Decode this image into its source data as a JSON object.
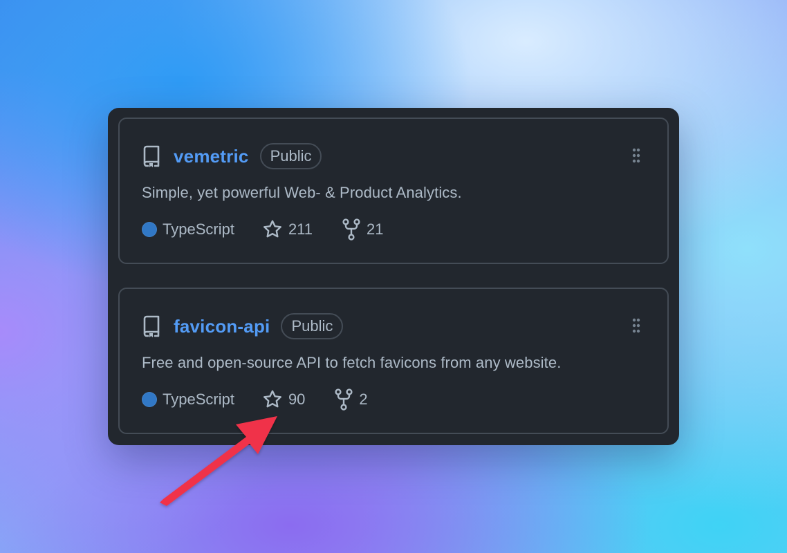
{
  "colors": {
    "panel_bg": "#22272e",
    "card_border": "#444c56",
    "repo_link": "#539bf5",
    "muted_text": "#adbac7",
    "typescript_dot": "#3178c6",
    "annotation_arrow": "#f0334a"
  },
  "repos": [
    {
      "icon": "repo-icon",
      "name": "vemetric",
      "visibility": "Public",
      "description": "Simple, yet powerful Web- & Product Analytics.",
      "language": "TypeScript",
      "stars": "211",
      "forks": "21"
    },
    {
      "icon": "repo-icon",
      "name": "favicon-api",
      "visibility": "Public",
      "description": "Free and open-source API to fetch favicons from any website.",
      "language": "TypeScript",
      "stars": "90",
      "forks": "2"
    }
  ],
  "annotation": {
    "type": "arrow",
    "points_to": "favicon-api star count"
  }
}
